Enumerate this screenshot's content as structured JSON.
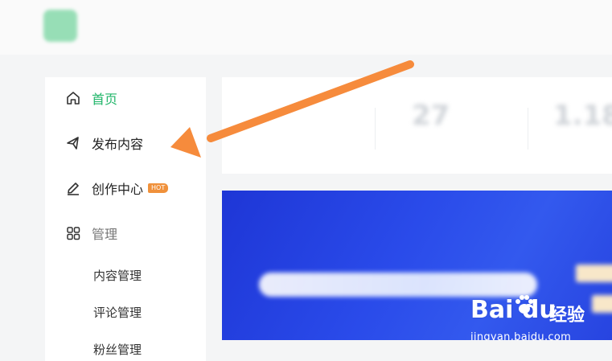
{
  "header": {
    "site_name": ""
  },
  "sidebar": {
    "items": [
      {
        "label": "首页",
        "icon": "home-icon",
        "state": "active"
      },
      {
        "label": "发布内容",
        "icon": "send-icon"
      },
      {
        "label": "创作中心",
        "icon": "pen-icon",
        "badge": "HOT"
      },
      {
        "label": "管理",
        "icon": "grid-icon"
      }
    ],
    "sub_items": [
      {
        "label": "内容管理"
      },
      {
        "label": "评论管理"
      },
      {
        "label": "粉丝管理"
      }
    ]
  },
  "stats": [
    {
      "value": "",
      "label": ""
    },
    {
      "value": "27",
      "label": ""
    },
    {
      "value": "1.18",
      "label": ""
    }
  ],
  "banner": {
    "title": ""
  },
  "watermark": {
    "brand": "Bai du",
    "brand_cn": "经验",
    "url": "jingyan.baidu.com"
  },
  "colors": {
    "accent": "#21b66a",
    "arrow": "#f68b3c",
    "banner": "#2a4bea",
    "badge": "#f0913b"
  }
}
